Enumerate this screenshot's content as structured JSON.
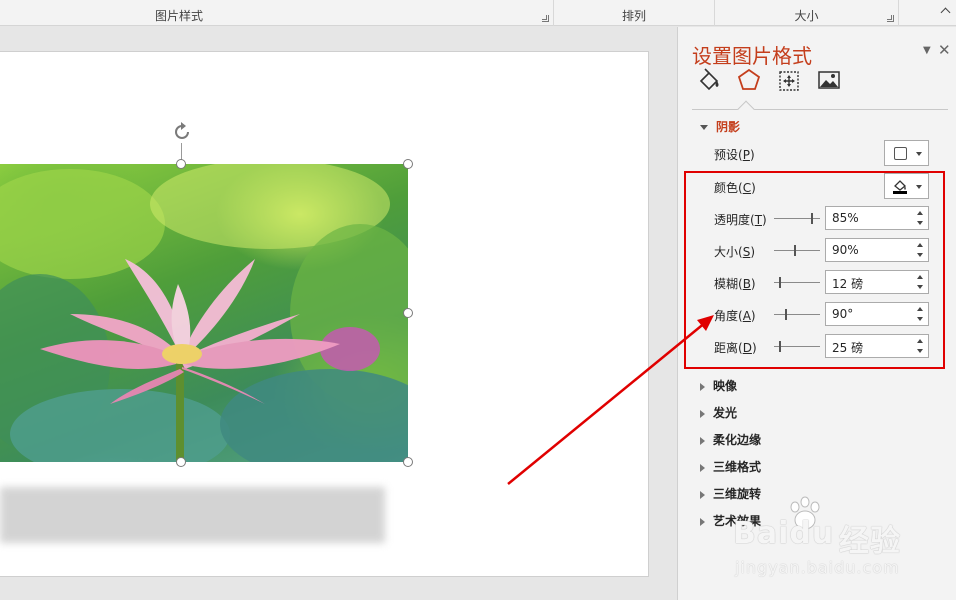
{
  "ribbon": {
    "groups": [
      {
        "label": "图片样式"
      },
      {
        "label": "排列"
      },
      {
        "label": "大小"
      }
    ]
  },
  "pane": {
    "title": "设置图片格式",
    "tabs": [
      "fill-line-icon",
      "effects-pentagon-icon",
      "size-properties-icon",
      "picture-icon"
    ],
    "active_tab": "effects-pentagon-icon",
    "shadow": {
      "header": "阴影",
      "preset": {
        "label": "预设(",
        "key": "P",
        "tail": ")"
      },
      "color": {
        "label": "颜色(",
        "key": "C",
        "tail": ")"
      },
      "rows": [
        {
          "label": "透明度(",
          "key": "T",
          "tail": ")",
          "value": "85%",
          "level": 0.85
        },
        {
          "label": "大小(",
          "key": "S",
          "tail": ")",
          "value": "90%",
          "level": 0.45
        },
        {
          "label": "模糊(",
          "key": "B",
          "tail": ")",
          "value": "12 磅",
          "level": 0.12
        },
        {
          "label": "角度(",
          "key": "A",
          "tail": ")",
          "value": "90°",
          "level": 0.25
        },
        {
          "label": "距离(",
          "key": "D",
          "tail": ")",
          "value": "25 磅",
          "level": 0.12
        }
      ]
    },
    "sections": [
      "映像",
      "发光",
      "柔化边缘",
      "三维格式",
      "三维旋转",
      "艺术效果"
    ]
  },
  "watermark": {
    "brand": "Baidu",
    "brand_cn": "经验",
    "url": "jingyan.baidu.com"
  },
  "colors": {
    "accent": "#c43e1c",
    "annotation_red": "#e00000"
  }
}
